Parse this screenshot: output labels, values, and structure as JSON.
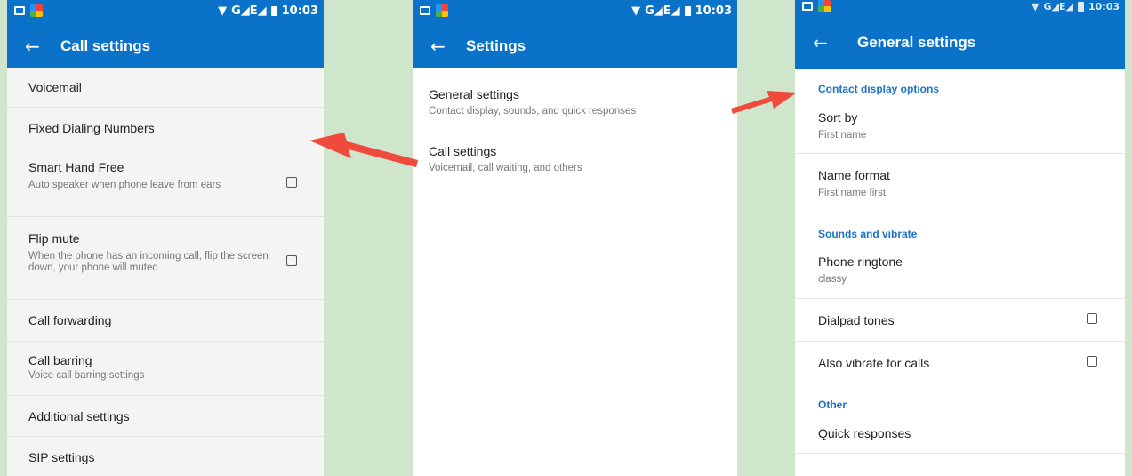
{
  "status": {
    "time": "10:03",
    "signal": "G◢E◢"
  },
  "screen1": {
    "title": "Call settings",
    "items": [
      {
        "title": "Voicemail"
      },
      {
        "title": "Fixed Dialing Numbers"
      },
      {
        "title": "Smart Hand Free",
        "subtitle": "Auto speaker when phone leave from ears",
        "checked": false
      },
      {
        "title": "Flip mute",
        "subtitle": "When the phone has an incoming call, flip the screen down, your phone will muted",
        "checked": false
      },
      {
        "title": "Call forwarding"
      },
      {
        "title": "Call barring",
        "subtitle": "Voice call barring settings"
      },
      {
        "title": "Additional settings"
      },
      {
        "title": "SIP settings"
      }
    ]
  },
  "screen2": {
    "title": "Settings",
    "items": [
      {
        "title": "General settings",
        "subtitle": "Contact display, sounds, and quick responses"
      },
      {
        "title": "Call settings",
        "subtitle": "Voicemail, call waiting, and others"
      }
    ]
  },
  "screen3": {
    "title": "General settings",
    "sections": {
      "contact": "Contact display options",
      "sounds": "Sounds and vibrate",
      "other": "Other"
    },
    "sort_by": {
      "title": "Sort by",
      "value": "First name"
    },
    "name_format": {
      "title": "Name format",
      "value": "First name first"
    },
    "ringtone": {
      "title": "Phone ringtone",
      "value": "classy"
    },
    "dialpad_tones": {
      "title": "Dialpad tones",
      "checked": false
    },
    "vibrate": {
      "title": "Also vibrate for calls",
      "checked": false
    },
    "quick_responses": {
      "title": "Quick responses"
    }
  },
  "colors": {
    "accent": "#0a73c9",
    "section": "#1a73c9",
    "arrow": "#f04a3c",
    "background": "#cfe6cc"
  }
}
